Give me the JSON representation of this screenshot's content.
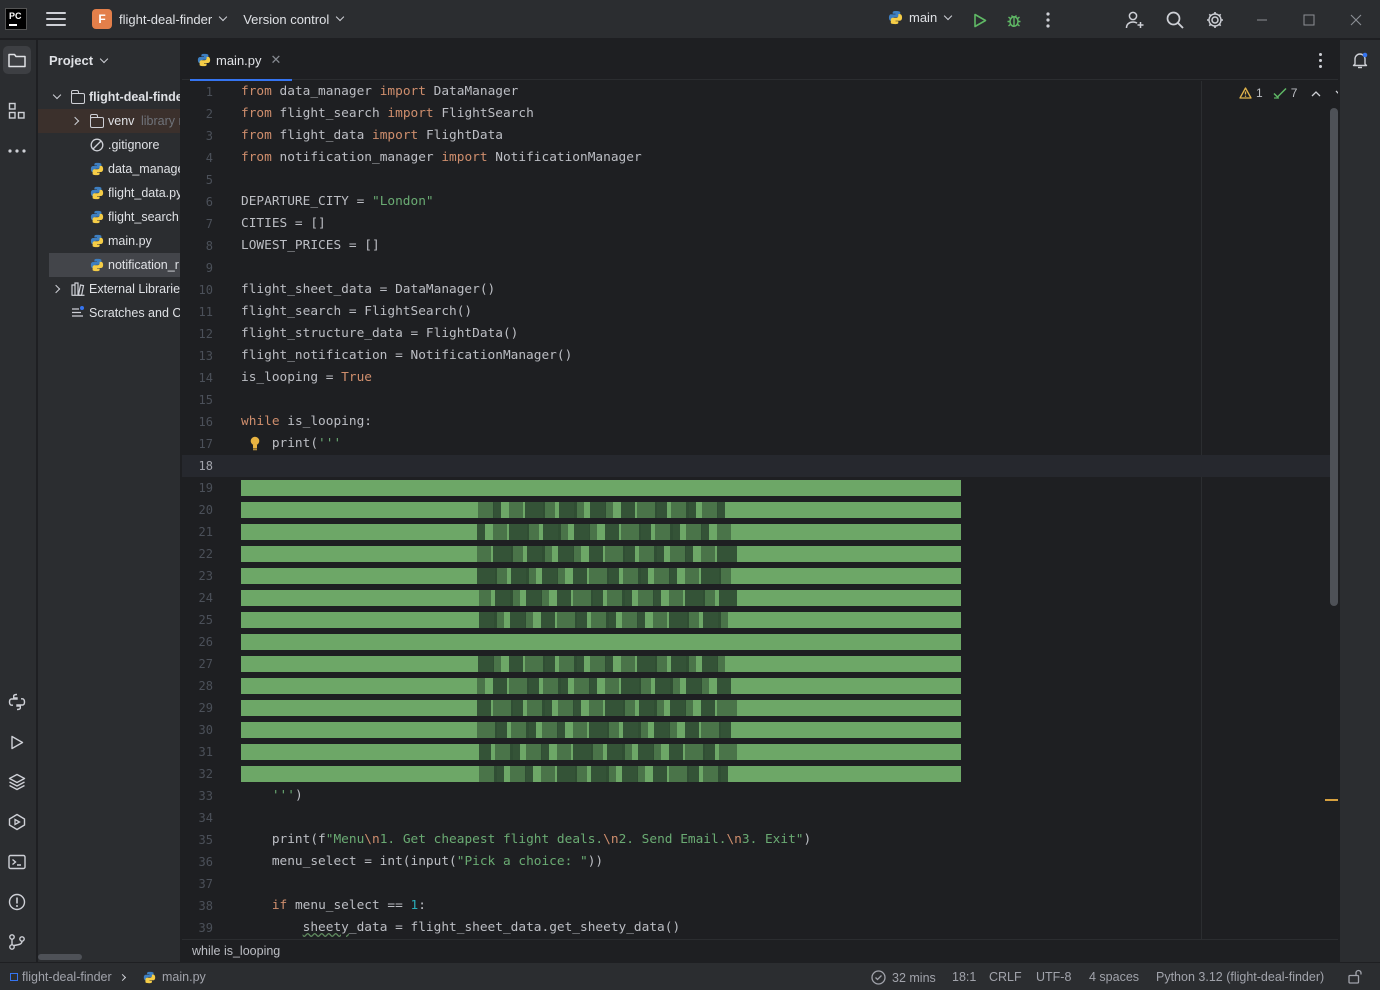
{
  "titlebar": {
    "logo": "PC",
    "project_badge": "F",
    "project_name": "flight-deal-finder",
    "version_control": "Version control",
    "branch": "main"
  },
  "project_panel": {
    "title": "Project",
    "tree": [
      {
        "label": "flight-deal-finde",
        "type": "folder",
        "expanded": true
      },
      {
        "label": "venv",
        "suffix": "library r",
        "type": "folder",
        "expanded": false
      },
      {
        "label": ".gitignore",
        "type": "ignore-file"
      },
      {
        "label": "data_manage",
        "type": "python-file"
      },
      {
        "label": "flight_data.py",
        "type": "python-file"
      },
      {
        "label": "flight_search.",
        "type": "python-file"
      },
      {
        "label": "main.py",
        "type": "python-file"
      },
      {
        "label": "notification_r",
        "type": "python-file",
        "selected": true
      },
      {
        "label": "External Librarie",
        "type": "library",
        "expanded": false
      },
      {
        "label": "Scratches and C",
        "type": "scratches"
      }
    ]
  },
  "editor": {
    "tab": "main.py",
    "inspections": {
      "warnings": "1",
      "ok": "7"
    },
    "current_line": 18,
    "lines": [
      {
        "n": "1",
        "tokens": [
          [
            "kw",
            "from"
          ],
          [
            "p",
            " data_manager "
          ],
          [
            "kw",
            "import"
          ],
          [
            "p",
            " DataManager"
          ]
        ]
      },
      {
        "n": "2",
        "tokens": [
          [
            "kw",
            "from"
          ],
          [
            "p",
            " flight_search "
          ],
          [
            "kw",
            "import"
          ],
          [
            "p",
            " FlightSearch"
          ]
        ]
      },
      {
        "n": "3",
        "tokens": [
          [
            "kw",
            "from"
          ],
          [
            "p",
            " flight_data "
          ],
          [
            "kw",
            "import"
          ],
          [
            "p",
            " FlightData"
          ]
        ]
      },
      {
        "n": "4",
        "tokens": [
          [
            "kw",
            "from"
          ],
          [
            "p",
            " notification_manager "
          ],
          [
            "kw",
            "import"
          ],
          [
            "p",
            " NotificationManager"
          ]
        ]
      },
      {
        "n": "5",
        "tokens": []
      },
      {
        "n": "6",
        "tokens": [
          [
            "p",
            "DEPARTURE_CITY = "
          ],
          [
            "str",
            "\"London\""
          ]
        ]
      },
      {
        "n": "7",
        "tokens": [
          [
            "p",
            "CITIES = []"
          ]
        ]
      },
      {
        "n": "8",
        "tokens": [
          [
            "p",
            "LOWEST_PRICES = []"
          ]
        ]
      },
      {
        "n": "9",
        "tokens": []
      },
      {
        "n": "10",
        "tokens": [
          [
            "p",
            "flight_sheet_data = DataManager()"
          ]
        ]
      },
      {
        "n": "11",
        "tokens": [
          [
            "p",
            "flight_search = FlightSearch()"
          ]
        ]
      },
      {
        "n": "12",
        "tokens": [
          [
            "p",
            "flight_structure_data = FlightData()"
          ]
        ]
      },
      {
        "n": "13",
        "tokens": [
          [
            "p",
            "flight_notification = NotificationManager()"
          ]
        ]
      },
      {
        "n": "14",
        "tokens": [
          [
            "p",
            "is_looping = "
          ],
          [
            "kw",
            "True"
          ]
        ]
      },
      {
        "n": "15",
        "tokens": []
      },
      {
        "n": "16",
        "tokens": [
          [
            "kw",
            "while"
          ],
          [
            "p",
            " is_looping:"
          ]
        ]
      },
      {
        "n": "17",
        "tokens": [
          [
            "p",
            "    print("
          ],
          [
            "str",
            "'''"
          ]
        ],
        "bulb": true
      },
      {
        "n": "18",
        "tokens": []
      },
      {
        "n": "19",
        "ascii": true
      },
      {
        "n": "20",
        "ascii": true
      },
      {
        "n": "21",
        "ascii": true
      },
      {
        "n": "22",
        "ascii": true
      },
      {
        "n": "23",
        "ascii": true
      },
      {
        "n": "24",
        "ascii": true
      },
      {
        "n": "25",
        "ascii": true
      },
      {
        "n": "26",
        "ascii": true
      },
      {
        "n": "27",
        "ascii": true
      },
      {
        "n": "28",
        "ascii": true
      },
      {
        "n": "29",
        "ascii": true
      },
      {
        "n": "30",
        "ascii": true
      },
      {
        "n": "31",
        "ascii": true
      },
      {
        "n": "32",
        "ascii": true
      },
      {
        "n": "33",
        "tokens": [
          [
            "str",
            "    '''"
          ],
          [
            "p",
            ")"
          ]
        ]
      },
      {
        "n": "34",
        "tokens": []
      },
      {
        "n": "35",
        "tokens": [
          [
            "p",
            "    print(f"
          ],
          [
            "str",
            "\"Menu"
          ],
          [
            "esc",
            "\\n"
          ],
          [
            "str",
            "1. Get cheapest flight deals."
          ],
          [
            "esc",
            "\\n"
          ],
          [
            "str",
            "2. Send Email."
          ],
          [
            "esc",
            "\\n"
          ],
          [
            "str",
            "3. Exit\""
          ],
          [
            "p",
            ")"
          ]
        ]
      },
      {
        "n": "36",
        "tokens": [
          [
            "p",
            "    menu_select = int(input("
          ],
          [
            "str",
            "\"Pick a choice: \""
          ],
          [
            "p",
            "))"
          ]
        ]
      },
      {
        "n": "37",
        "tokens": []
      },
      {
        "n": "38",
        "tokens": [
          [
            "p",
            "    "
          ],
          [
            "kw",
            "if"
          ],
          [
            "p",
            " menu_select == "
          ],
          [
            "num",
            "1"
          ],
          [
            "p",
            ":"
          ]
        ]
      },
      {
        "n": "39",
        "tokens": [
          [
            "p",
            "        "
          ],
          [
            "sq",
            "sheety"
          ],
          [
            "p",
            "_data = flight_sheet_data.get_sheety_data()"
          ]
        ]
      }
    ]
  },
  "breadcrumb": "while is_looping",
  "statusbar": {
    "project": "flight-deal-finder",
    "file": "main.py",
    "time": "32 mins",
    "position": "18:1",
    "line_sep": "CRLF",
    "encoding": "UTF-8",
    "indent": "4 spaces",
    "interpreter": "Python 3.12 (flight-deal-finder)"
  },
  "colors": {
    "keyword": "#cf8e6d",
    "string": "#6aab73",
    "number": "#2aacb8",
    "accent": "#3574f0",
    "ascii_art": "#7bbf73"
  }
}
